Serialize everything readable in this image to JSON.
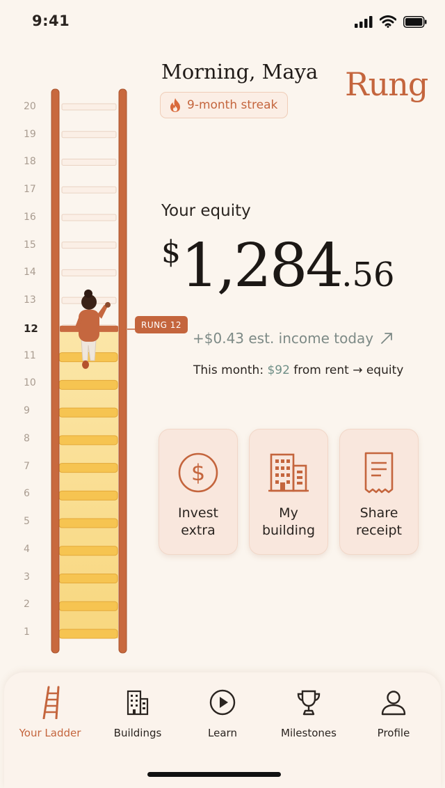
{
  "status": {
    "time": "9:41",
    "signal_icon": "signal-icon",
    "wifi_icon": "wifi-icon",
    "battery_icon": "battery-icon"
  },
  "header": {
    "greeting": "Morning, Maya",
    "streak": "9-month streak",
    "streak_icon": "flame-icon",
    "logo": "Rung"
  },
  "ladder": {
    "rungs": [
      "20",
      "19",
      "18",
      "17",
      "16",
      "15",
      "14",
      "13",
      "12",
      "11",
      "10",
      "9",
      "8",
      "7",
      "6",
      "5",
      "4",
      "3",
      "2",
      "1"
    ],
    "current_rung": 12,
    "current_tag": "RUNG 12",
    "filled_rungs": 11,
    "total_rungs": 20,
    "climber_icon": "climber-figure"
  },
  "equity": {
    "label": "Your equity",
    "currency": "$",
    "whole": "1,284",
    "cents": ".56",
    "income": "+$0.43 est. income today",
    "income_icon": "trend-up-arrow-icon",
    "month_prefix": "This month: ",
    "month_amount": "$92",
    "month_suffix": " from rent → equity"
  },
  "actions": [
    {
      "label": "Invest\nextra",
      "icon": "dollar-coin-icon"
    },
    {
      "label": "My\nbuilding",
      "icon": "building-icon"
    },
    {
      "label": "Share\nreceipt",
      "icon": "receipt-icon"
    }
  ],
  "tabs": [
    {
      "label": "Your Ladder",
      "icon": "ladder-icon",
      "active": true
    },
    {
      "label": "Buildings",
      "icon": "buildings-icon"
    },
    {
      "label": "Learn",
      "icon": "play-icon"
    },
    {
      "label": "Milestones",
      "icon": "trophy-icon"
    },
    {
      "label": "Profile",
      "icon": "profile-icon"
    }
  ],
  "colors": {
    "accent": "#c4653d",
    "background": "#fbf5ee",
    "filled_rung": "#f6c451",
    "empty_rung": "#fbefe6",
    "income": "#7d8a86"
  }
}
